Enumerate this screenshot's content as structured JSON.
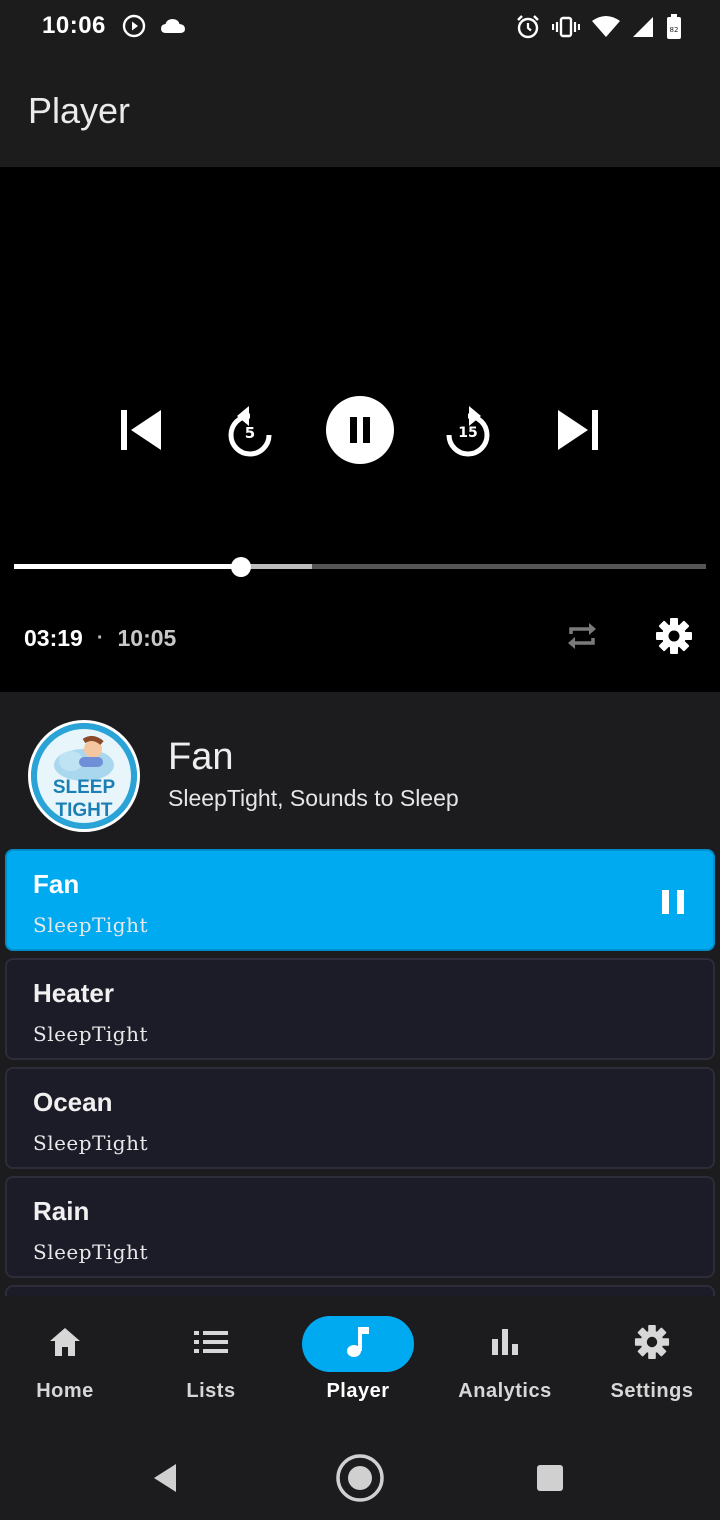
{
  "status_bar": {
    "time": "10:06",
    "left_icons": [
      "play-circle-icon",
      "cloud-icon"
    ],
    "right_icons": [
      "alarm-icon",
      "vibrate-icon",
      "wifi-icon",
      "signal-icon",
      "battery-icon"
    ],
    "battery_level": "82"
  },
  "app_bar": {
    "title": "Player"
  },
  "player": {
    "controls": [
      "skip-previous-icon",
      "replay-5-icon",
      "pause-icon",
      "forward-15-icon",
      "skip-next-icon"
    ],
    "replay_seconds": "5",
    "forward_seconds": "15",
    "position": "03:19",
    "separator": "·",
    "duration": "10:05",
    "progress_fraction": 0.328,
    "buffered_fraction": 0.43
  },
  "now_playing": {
    "title": "Fan",
    "subtitle": "SleepTight, Sounds to Sleep",
    "artwork_text": "SLEEP TIGHT"
  },
  "queue": [
    {
      "title": "Fan",
      "subtitle": "SleepTight",
      "active": true
    },
    {
      "title": "Heater",
      "subtitle": "SleepTight",
      "active": false
    },
    {
      "title": "Ocean",
      "subtitle": "SleepTight",
      "active": false
    },
    {
      "title": "Rain",
      "subtitle": "SleepTight",
      "active": false
    }
  ],
  "bottom_nav": [
    {
      "label": "Home",
      "icon": "home-icon",
      "active": false
    },
    {
      "label": "Lists",
      "icon": "list-icon",
      "active": false
    },
    {
      "label": "Player",
      "icon": "music-note-icon",
      "active": true
    },
    {
      "label": "Analytics",
      "icon": "bar-chart-icon",
      "active": false
    },
    {
      "label": "Settings",
      "icon": "gear-icon",
      "active": false
    }
  ],
  "colors": {
    "accent": "#00aaf0",
    "background": "#1c1c1e",
    "video_bg": "#000000",
    "queue_item_bg": "#1c1b28"
  }
}
